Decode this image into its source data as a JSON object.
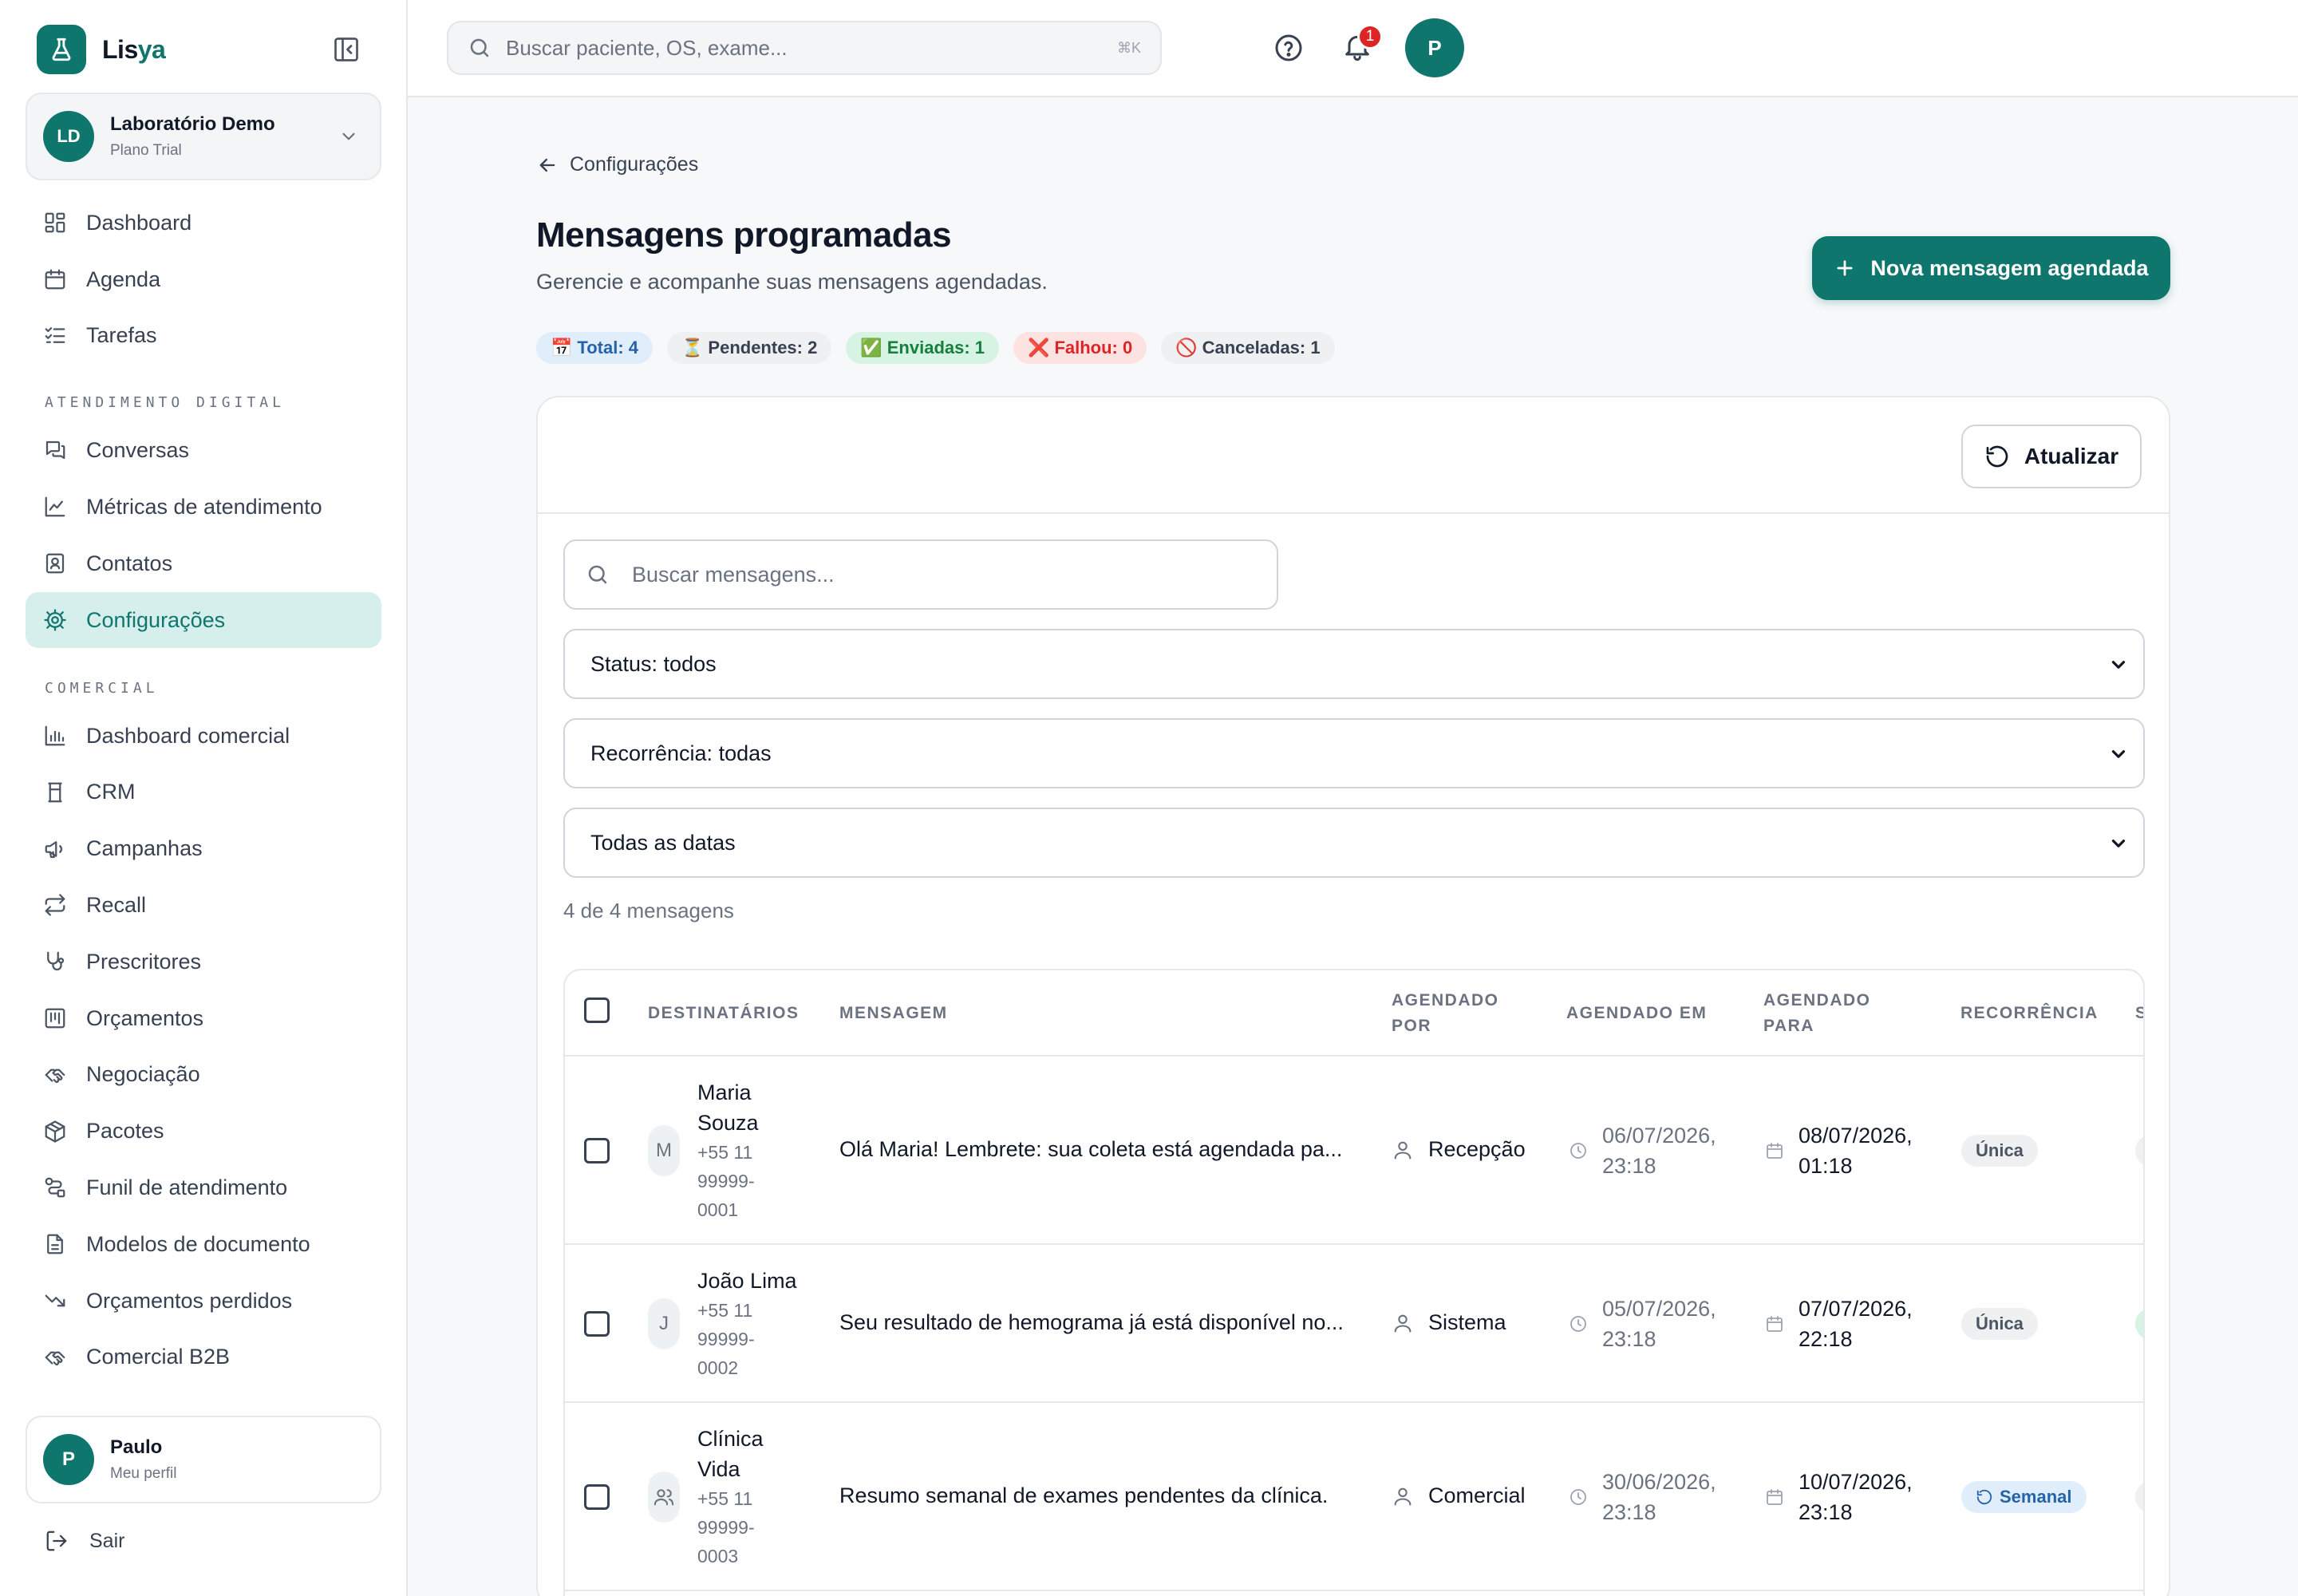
{
  "brand": {
    "name_part1": "Lis",
    "name_part2": "ya"
  },
  "org": {
    "initials": "LD",
    "name": "Laboratório Demo",
    "plan": "Plano Trial"
  },
  "sidebar": {
    "items_top": [
      {
        "label": "Dashboard",
        "icon": "dashboard-icon"
      },
      {
        "label": "Agenda",
        "icon": "calendar-icon"
      },
      {
        "label": "Tarefas",
        "icon": "tasks-icon"
      }
    ],
    "section_digital": "ATENDIMENTO DIGITAL",
    "items_digital": [
      {
        "label": "Conversas",
        "icon": "chat-icon"
      },
      {
        "label": "Métricas de atendimento",
        "icon": "line-chart-icon"
      },
      {
        "label": "Contatos",
        "icon": "contact-icon"
      },
      {
        "label": "Configurações",
        "icon": "gear-icon",
        "active": true
      }
    ],
    "section_comercial": "COMERCIAL",
    "items_comercial": [
      {
        "label": "Dashboard comercial",
        "icon": "bar-chart-icon"
      },
      {
        "label": "CRM",
        "icon": "crm-icon"
      },
      {
        "label": "Campanhas",
        "icon": "megaphone-icon"
      },
      {
        "label": "Recall",
        "icon": "repeat-icon"
      },
      {
        "label": "Prescritores",
        "icon": "stethoscope-icon"
      },
      {
        "label": "Orçamentos",
        "icon": "quote-icon"
      },
      {
        "label": "Negociação",
        "icon": "handshake-icon"
      },
      {
        "label": "Pacotes",
        "icon": "package-icon"
      },
      {
        "label": "Funil de atendimento",
        "icon": "funnel-icon"
      },
      {
        "label": "Modelos de documento",
        "icon": "document-icon"
      },
      {
        "label": "Orçamentos perdidos",
        "icon": "trend-down-icon"
      },
      {
        "label": "Comercial B2B",
        "icon": "handshake-b2b-icon"
      }
    ]
  },
  "user": {
    "initial": "P",
    "name": "Paulo",
    "sub": "Meu perfil"
  },
  "logout_label": "Sair",
  "topbar": {
    "search_placeholder": "Buscar paciente, OS, exame...",
    "shortcut": "⌘K",
    "notification_count": "1",
    "avatar_initial": "P"
  },
  "page": {
    "back_label": "Configurações",
    "title": "Mensagens programadas",
    "subtitle": "Gerencie e acompanhe suas mensagens agendadas.",
    "new_button": "Nova mensagem agendada"
  },
  "stats": [
    {
      "emoji": "📅",
      "label": "Total: 4",
      "kind": "total"
    },
    {
      "emoji": "⏳",
      "label": "Pendentes: 2",
      "kind": "pend"
    },
    {
      "emoji": "✅",
      "label": "Enviadas: 1",
      "kind": "sent"
    },
    {
      "emoji": "❌",
      "label": "Falhou: 0",
      "kind": "fail"
    },
    {
      "emoji": "🚫",
      "label": "Canceladas: 1",
      "kind": "canc"
    }
  ],
  "panel": {
    "refresh_label": "Atualizar",
    "search_placeholder": "Buscar mensagens...",
    "filter_status": "Status: todos",
    "filter_recurrence": "Recorrência: todas",
    "filter_dates": "Todas as datas",
    "count_text": "4 de 4 mensagens"
  },
  "table": {
    "headers": {
      "recipients": "DESTINATÁRIOS",
      "message": "MENSAGEM",
      "by_1": "AGENDADO",
      "by_2": "POR",
      "at": "AGENDADO EM",
      "for_1": "AGENDADO",
      "for_2": "PARA",
      "recurrence": "RECORRÊNCIA",
      "status_partial": "S"
    },
    "rows": [
      {
        "avatar": "M",
        "name_lines": [
          "Maria",
          "Souza"
        ],
        "phone_lines": [
          "+55 11",
          "99999-",
          "0001"
        ],
        "message": "Olá Maria! Lembrete: sua coleta está agendada pa...",
        "by": "Recepção",
        "at_lines": [
          "06/07/2026,",
          "23:18"
        ],
        "for_lines": [
          "08/07/2026,",
          "01:18"
        ],
        "recurrence": "Única",
        "recurrence_kind": "unica",
        "status_color": "#eef0f2"
      },
      {
        "avatar": "J",
        "name_lines": [
          "João Lima"
        ],
        "phone_lines": [
          "+55 11",
          "99999-",
          "0002"
        ],
        "message": "Seu resultado de hemograma já está disponível no...",
        "by": "Sistema",
        "at_lines": [
          "05/07/2026,",
          "23:18"
        ],
        "for_lines": [
          "07/07/2026,",
          "22:18"
        ],
        "recurrence": "Única",
        "recurrence_kind": "unica",
        "status_color": "#d7f3e4"
      },
      {
        "avatar": "group-icon",
        "name_lines": [
          "Clínica",
          "Vida"
        ],
        "phone_lines": [
          "+55 11",
          "99999-",
          "0003"
        ],
        "message": "Resumo semanal de exames pendentes da clínica.",
        "by": "Comercial",
        "at_lines": [
          "30/06/2026,",
          "23:18"
        ],
        "for_lines": [
          "10/07/2026,",
          "23:18"
        ],
        "recurrence": "Semanal",
        "recurrence_kind": "semanal",
        "status_color": "#eef0f2"
      }
    ]
  },
  "colors": {
    "accent": "#0f766e",
    "accent_soft": "#d6efec",
    "danger": "#dc2626"
  }
}
